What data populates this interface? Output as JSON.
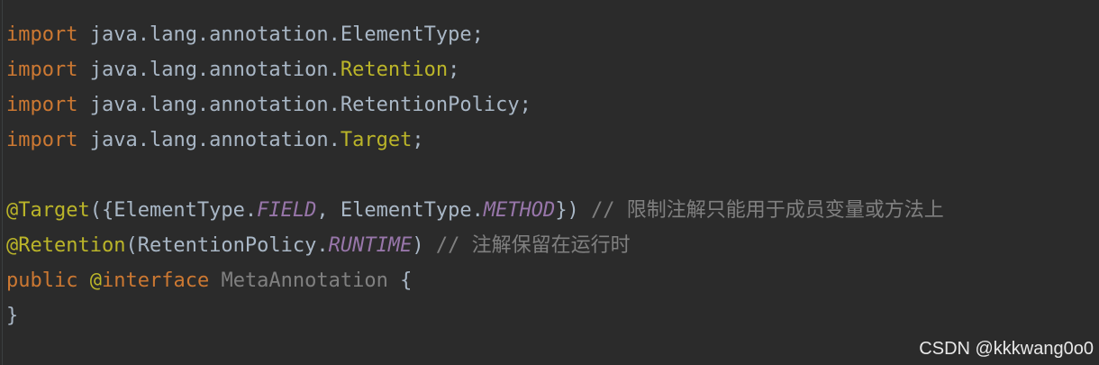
{
  "editor": {
    "lines": [
      {
        "kw": "import",
        "pkg": " java.lang.annotation.",
        "cls": "ElementType",
        "end": ";"
      },
      {
        "kw": "import",
        "pkg": " java.lang.annotation.",
        "cls": "Retention",
        "end": ";"
      },
      {
        "kw": "import",
        "pkg": " java.lang.annotation.",
        "cls": "RetentionPolicy",
        "end": ";"
      },
      {
        "kw": "import",
        "pkg": " java.lang.annotation.",
        "cls": "Target",
        "end": ";"
      }
    ],
    "annotation1": {
      "name": "@Target",
      "open": "({ElementType.",
      "const1": "FIELD",
      "mid": ", ElementType.",
      "const2": "METHOD",
      "close": "}) ",
      "comment": "// 限制注解只能用于成员变量或方法上"
    },
    "annotation2": {
      "name": "@Retention",
      "open": "(RetentionPolicy.",
      "const1": "RUNTIME",
      "close": ") ",
      "comment": "// 注解保留在运行时"
    },
    "declaration": {
      "kw": "public",
      "at": " @",
      "iface_kw": "interface",
      "name": " MetaAnnotation",
      "brace": " {"
    },
    "closing_brace": "}"
  },
  "watermark": "CSDN @kkkwang0o0",
  "colors": {
    "background": "#2b2b2b",
    "keyword": "#cc7832",
    "annotation": "#bbb529",
    "constant": "#9876aa",
    "comment": "#808080",
    "text": "#a9b7c6"
  }
}
